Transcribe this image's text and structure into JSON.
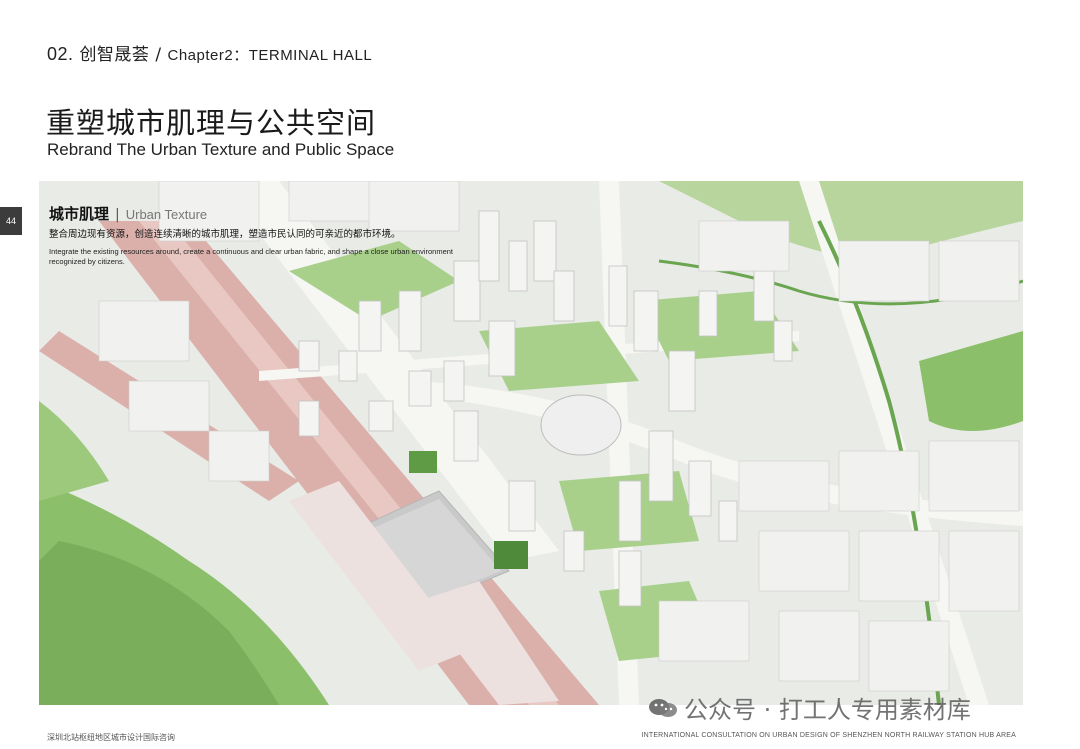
{
  "header": {
    "chapter_num": "02.",
    "chapter_cn": "创智晟荟",
    "chapter_sep": "/",
    "chapter_en": "Chapter2：TERMINAL HALL"
  },
  "title": {
    "cn": "重塑城市肌理与公共空间",
    "en": "Rebrand The Urban Texture and Public Space"
  },
  "page_number": "44",
  "map": {
    "heading_cn": "城市肌理",
    "heading_sep": "|",
    "heading_en": "Urban Texture",
    "desc_cn": "整合周边现有资源，创造连续清晰的城市肌理，塑造市民认同的可亲近的都市环境。",
    "desc_en": "Integrate the existing resources around, create a continuous and clear urban fabric, and shape a close urban environment recognized by citizens."
  },
  "footer": {
    "left": "深圳北站枢纽地区城市设计国际咨询",
    "right": "INTERNATIONAL CONSULTATION ON URBAN DESIGN OF SHENZHEN NORTH RAILWAY STATION HUB AREA"
  },
  "watermark": {
    "text": "公众号 · 打工人专用素材库",
    "icon": "wechat-icon"
  },
  "colors": {
    "green": "#8bbf6a",
    "rail_pink": "#d9a9a3",
    "building": "#f4f4f2",
    "ground": "#e9ebe7"
  }
}
